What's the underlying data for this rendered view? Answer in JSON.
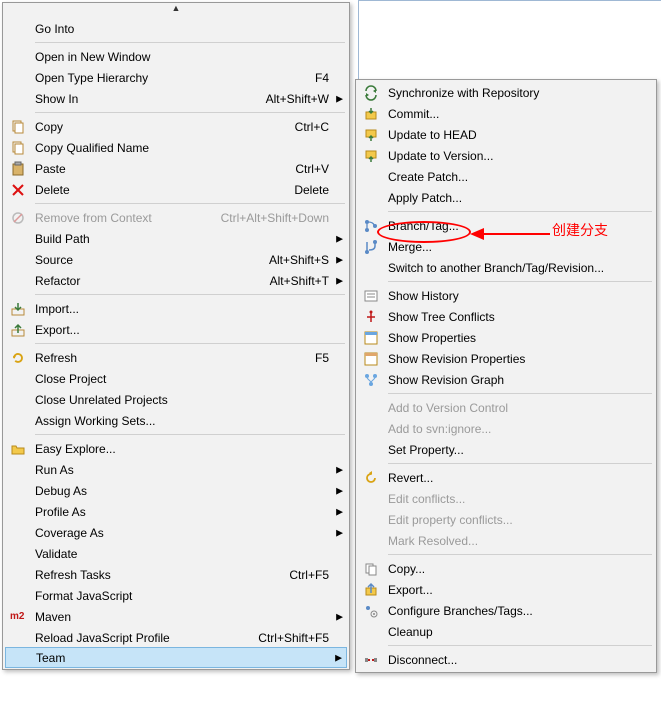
{
  "annotation": {
    "text": "创建分支"
  },
  "leftMenu": {
    "items": [
      {
        "type": "item",
        "label": "Go Into",
        "shortcut": "",
        "icon": "",
        "arrow": false,
        "disabled": false
      },
      {
        "type": "sep"
      },
      {
        "type": "item",
        "label": "Open in New Window",
        "shortcut": "",
        "icon": "",
        "arrow": false,
        "disabled": false
      },
      {
        "type": "item",
        "label": "Open Type Hierarchy",
        "shortcut": "F4",
        "icon": "",
        "arrow": false,
        "disabled": false
      },
      {
        "type": "item",
        "label": "Show In",
        "shortcut": "Alt+Shift+W",
        "icon": "",
        "arrow": true,
        "disabled": false
      },
      {
        "type": "sep"
      },
      {
        "type": "item",
        "label": "Copy",
        "shortcut": "Ctrl+C",
        "icon": "copy",
        "arrow": false,
        "disabled": false
      },
      {
        "type": "item",
        "label": "Copy Qualified Name",
        "shortcut": "",
        "icon": "copy",
        "arrow": false,
        "disabled": false
      },
      {
        "type": "item",
        "label": "Paste",
        "shortcut": "Ctrl+V",
        "icon": "paste",
        "arrow": false,
        "disabled": false
      },
      {
        "type": "item",
        "label": "Delete",
        "shortcut": "Delete",
        "icon": "delete",
        "arrow": false,
        "disabled": false
      },
      {
        "type": "sep"
      },
      {
        "type": "item",
        "label": "Remove from Context",
        "shortcut": "Ctrl+Alt+Shift+Down",
        "icon": "remove-ctx",
        "arrow": false,
        "disabled": true
      },
      {
        "type": "item",
        "label": "Build Path",
        "shortcut": "",
        "icon": "",
        "arrow": true,
        "disabled": false
      },
      {
        "type": "item",
        "label": "Source",
        "shortcut": "Alt+Shift+S",
        "icon": "",
        "arrow": true,
        "disabled": false
      },
      {
        "type": "item",
        "label": "Refactor",
        "shortcut": "Alt+Shift+T",
        "icon": "",
        "arrow": true,
        "disabled": false
      },
      {
        "type": "sep"
      },
      {
        "type": "item",
        "label": "Import...",
        "shortcut": "",
        "icon": "import",
        "arrow": false,
        "disabled": false
      },
      {
        "type": "item",
        "label": "Export...",
        "shortcut": "",
        "icon": "export",
        "arrow": false,
        "disabled": false
      },
      {
        "type": "sep"
      },
      {
        "type": "item",
        "label": "Refresh",
        "shortcut": "F5",
        "icon": "refresh",
        "arrow": false,
        "disabled": false
      },
      {
        "type": "item",
        "label": "Close Project",
        "shortcut": "",
        "icon": "",
        "arrow": false,
        "disabled": false
      },
      {
        "type": "item",
        "label": "Close Unrelated Projects",
        "shortcut": "",
        "icon": "",
        "arrow": false,
        "disabled": false
      },
      {
        "type": "item",
        "label": "Assign Working Sets...",
        "shortcut": "",
        "icon": "",
        "arrow": false,
        "disabled": false
      },
      {
        "type": "sep"
      },
      {
        "type": "item",
        "label": "Easy Explore...",
        "shortcut": "",
        "icon": "folder",
        "arrow": false,
        "disabled": false
      },
      {
        "type": "item",
        "label": "Run As",
        "shortcut": "",
        "icon": "",
        "arrow": true,
        "disabled": false
      },
      {
        "type": "item",
        "label": "Debug As",
        "shortcut": "",
        "icon": "",
        "arrow": true,
        "disabled": false
      },
      {
        "type": "item",
        "label": "Profile As",
        "shortcut": "",
        "icon": "",
        "arrow": true,
        "disabled": false
      },
      {
        "type": "item",
        "label": "Coverage As",
        "shortcut": "",
        "icon": "",
        "arrow": true,
        "disabled": false
      },
      {
        "type": "item",
        "label": "Validate",
        "shortcut": "",
        "icon": "",
        "arrow": false,
        "disabled": false
      },
      {
        "type": "item",
        "label": "Refresh Tasks",
        "shortcut": "Ctrl+F5",
        "icon": "",
        "arrow": false,
        "disabled": false
      },
      {
        "type": "item",
        "label": "Format JavaScript",
        "shortcut": "",
        "icon": "",
        "arrow": false,
        "disabled": false
      },
      {
        "type": "item",
        "label": "Maven",
        "shortcut": "",
        "icon": "m2",
        "arrow": true,
        "disabled": false
      },
      {
        "type": "item",
        "label": "Reload JavaScript Profile",
        "shortcut": "Ctrl+Shift+F5",
        "icon": "",
        "arrow": false,
        "disabled": false
      },
      {
        "type": "item",
        "label": "Team",
        "shortcut": "",
        "icon": "",
        "arrow": true,
        "disabled": false,
        "highlight": true
      }
    ]
  },
  "rightMenu": {
    "items": [
      {
        "type": "item",
        "label": "Synchronize with Repository",
        "icon": "sync",
        "arrow": false,
        "disabled": false
      },
      {
        "type": "item",
        "label": "Commit...",
        "icon": "commit",
        "arrow": false,
        "disabled": false
      },
      {
        "type": "item",
        "label": "Update to HEAD",
        "icon": "update",
        "arrow": false,
        "disabled": false
      },
      {
        "type": "item",
        "label": "Update to Version...",
        "icon": "update",
        "arrow": false,
        "disabled": false
      },
      {
        "type": "item",
        "label": "Create Patch...",
        "icon": "",
        "arrow": false,
        "disabled": false
      },
      {
        "type": "item",
        "label": "Apply Patch...",
        "icon": "",
        "arrow": false,
        "disabled": false
      },
      {
        "type": "sep"
      },
      {
        "type": "item",
        "label": "Branch/Tag...",
        "icon": "branch",
        "arrow": false,
        "disabled": false
      },
      {
        "type": "item",
        "label": "Merge...",
        "icon": "merge",
        "arrow": false,
        "disabled": false
      },
      {
        "type": "item",
        "label": "Switch to another Branch/Tag/Revision...",
        "icon": "",
        "arrow": false,
        "disabled": false
      },
      {
        "type": "sep"
      },
      {
        "type": "item",
        "label": "Show History",
        "icon": "history",
        "arrow": false,
        "disabled": false
      },
      {
        "type": "item",
        "label": "Show Tree Conflicts",
        "icon": "tree-conflict",
        "arrow": false,
        "disabled": false
      },
      {
        "type": "item",
        "label": "Show Properties",
        "icon": "properties",
        "arrow": false,
        "disabled": false
      },
      {
        "type": "item",
        "label": "Show Revision Properties",
        "icon": "rev-properties",
        "arrow": false,
        "disabled": false
      },
      {
        "type": "item",
        "label": "Show Revision Graph",
        "icon": "rev-graph",
        "arrow": false,
        "disabled": false
      },
      {
        "type": "sep"
      },
      {
        "type": "item",
        "label": "Add to Version Control",
        "icon": "",
        "arrow": false,
        "disabled": true
      },
      {
        "type": "item",
        "label": "Add to svn:ignore...",
        "icon": "",
        "arrow": false,
        "disabled": true
      },
      {
        "type": "item",
        "label": "Set Property...",
        "icon": "",
        "arrow": false,
        "disabled": false
      },
      {
        "type": "sep"
      },
      {
        "type": "item",
        "label": "Revert...",
        "icon": "revert",
        "arrow": false,
        "disabled": false
      },
      {
        "type": "item",
        "label": "Edit conflicts...",
        "icon": "",
        "arrow": false,
        "disabled": true
      },
      {
        "type": "item",
        "label": "Edit property conflicts...",
        "icon": "",
        "arrow": false,
        "disabled": true
      },
      {
        "type": "item",
        "label": "Mark Resolved...",
        "icon": "",
        "arrow": false,
        "disabled": true
      },
      {
        "type": "sep"
      },
      {
        "type": "item",
        "label": "Copy...",
        "icon": "svn-copy",
        "arrow": false,
        "disabled": false
      },
      {
        "type": "item",
        "label": "Export...",
        "icon": "svn-export",
        "arrow": false,
        "disabled": false
      },
      {
        "type": "item",
        "label": "Configure Branches/Tags...",
        "icon": "config-branch",
        "arrow": false,
        "disabled": false
      },
      {
        "type": "item",
        "label": "Cleanup",
        "icon": "",
        "arrow": false,
        "disabled": false
      },
      {
        "type": "sep"
      },
      {
        "type": "item",
        "label": "Disconnect...",
        "icon": "disconnect",
        "arrow": false,
        "disabled": false
      }
    ]
  }
}
